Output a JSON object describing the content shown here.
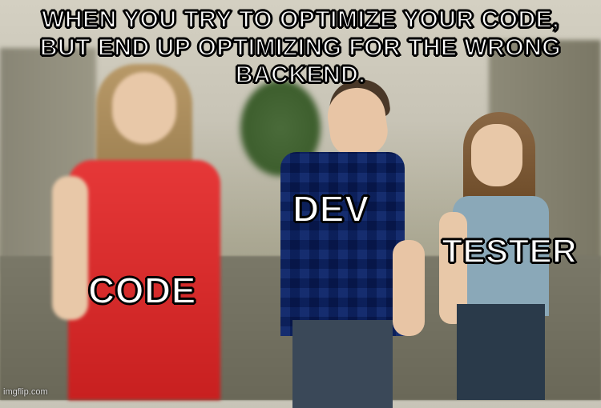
{
  "caption": "WHEN YOU TRY TO OPTIMIZE YOUR CODE,\nBUT END UP OPTIMIZING FOR THE WRONG BACKEND.",
  "labels": {
    "left": "CODE",
    "center": "DEV",
    "right": "TESTER"
  },
  "watermark": "imgflip.com"
}
